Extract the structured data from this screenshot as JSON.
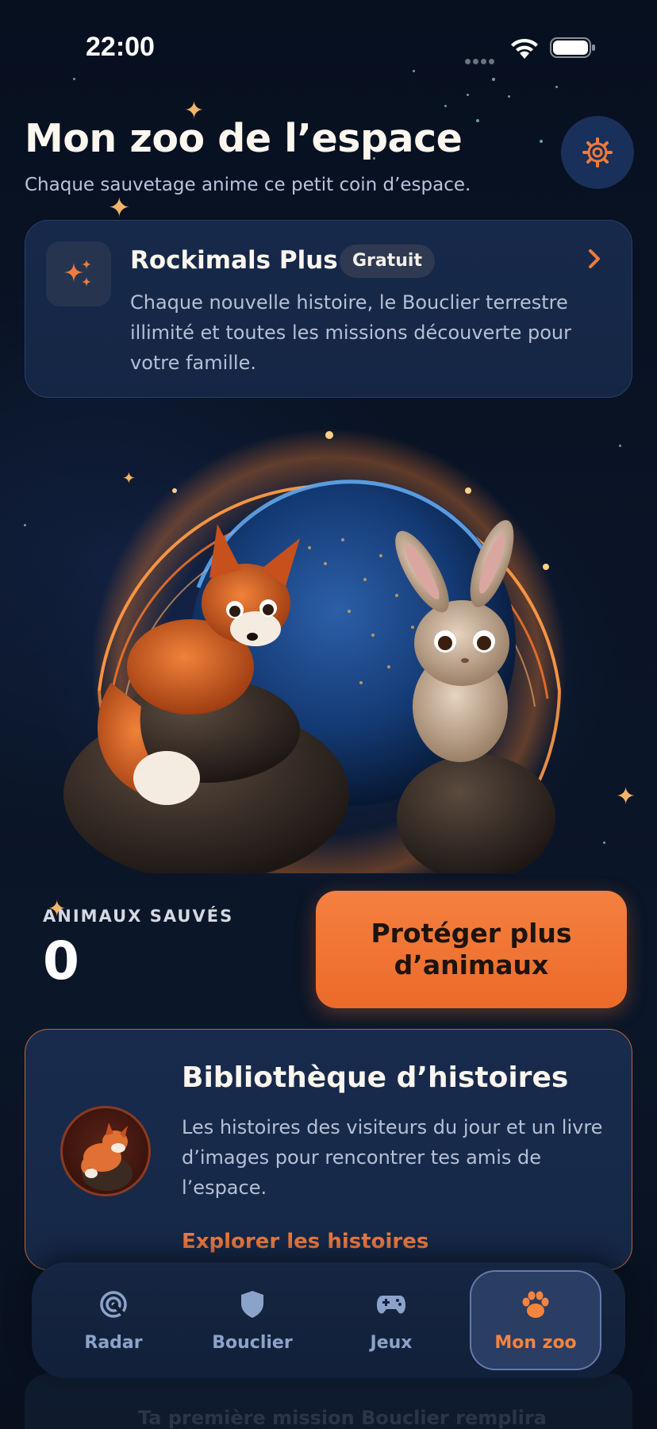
{
  "status_bar": {
    "time": "22:00"
  },
  "header": {
    "title": "Mon zoo de l’espace",
    "subtitle": "Chaque sauvetage anime ce petit coin d’espace."
  },
  "promo": {
    "title": "Rockimals Plus",
    "badge": "Gratuit",
    "description": "Chaque nouvelle histoire, le Bouclier terrestre illimité et toutes les missions découverte pour votre famille."
  },
  "stats": {
    "label": "ANIMAUX SAUVÉS",
    "value": "0"
  },
  "protect_button": {
    "label": "Protéger plus d’animaux"
  },
  "library": {
    "title": "Bibliothèque d’histoires",
    "description": "Les histoires des visiteurs du jour et un livre d’images pour rencontrer tes amis de l’espace.",
    "link": "Explorer les histoires"
  },
  "behind": {
    "mission_text": "Ta première mission Bouclier remplira"
  },
  "nav": {
    "items": [
      {
        "label": "Radar",
        "icon": "radar-icon"
      },
      {
        "label": "Bouclier",
        "icon": "shield-icon"
      },
      {
        "label": "Jeux",
        "icon": "gamepad-icon"
      },
      {
        "label": "Mon zoo",
        "icon": "paw-icon",
        "active": true
      }
    ]
  },
  "colors": {
    "accent": "#f07b3f",
    "background": "#0a1426",
    "card": "#17294a",
    "nav_inactive": "#8ca3c9"
  }
}
